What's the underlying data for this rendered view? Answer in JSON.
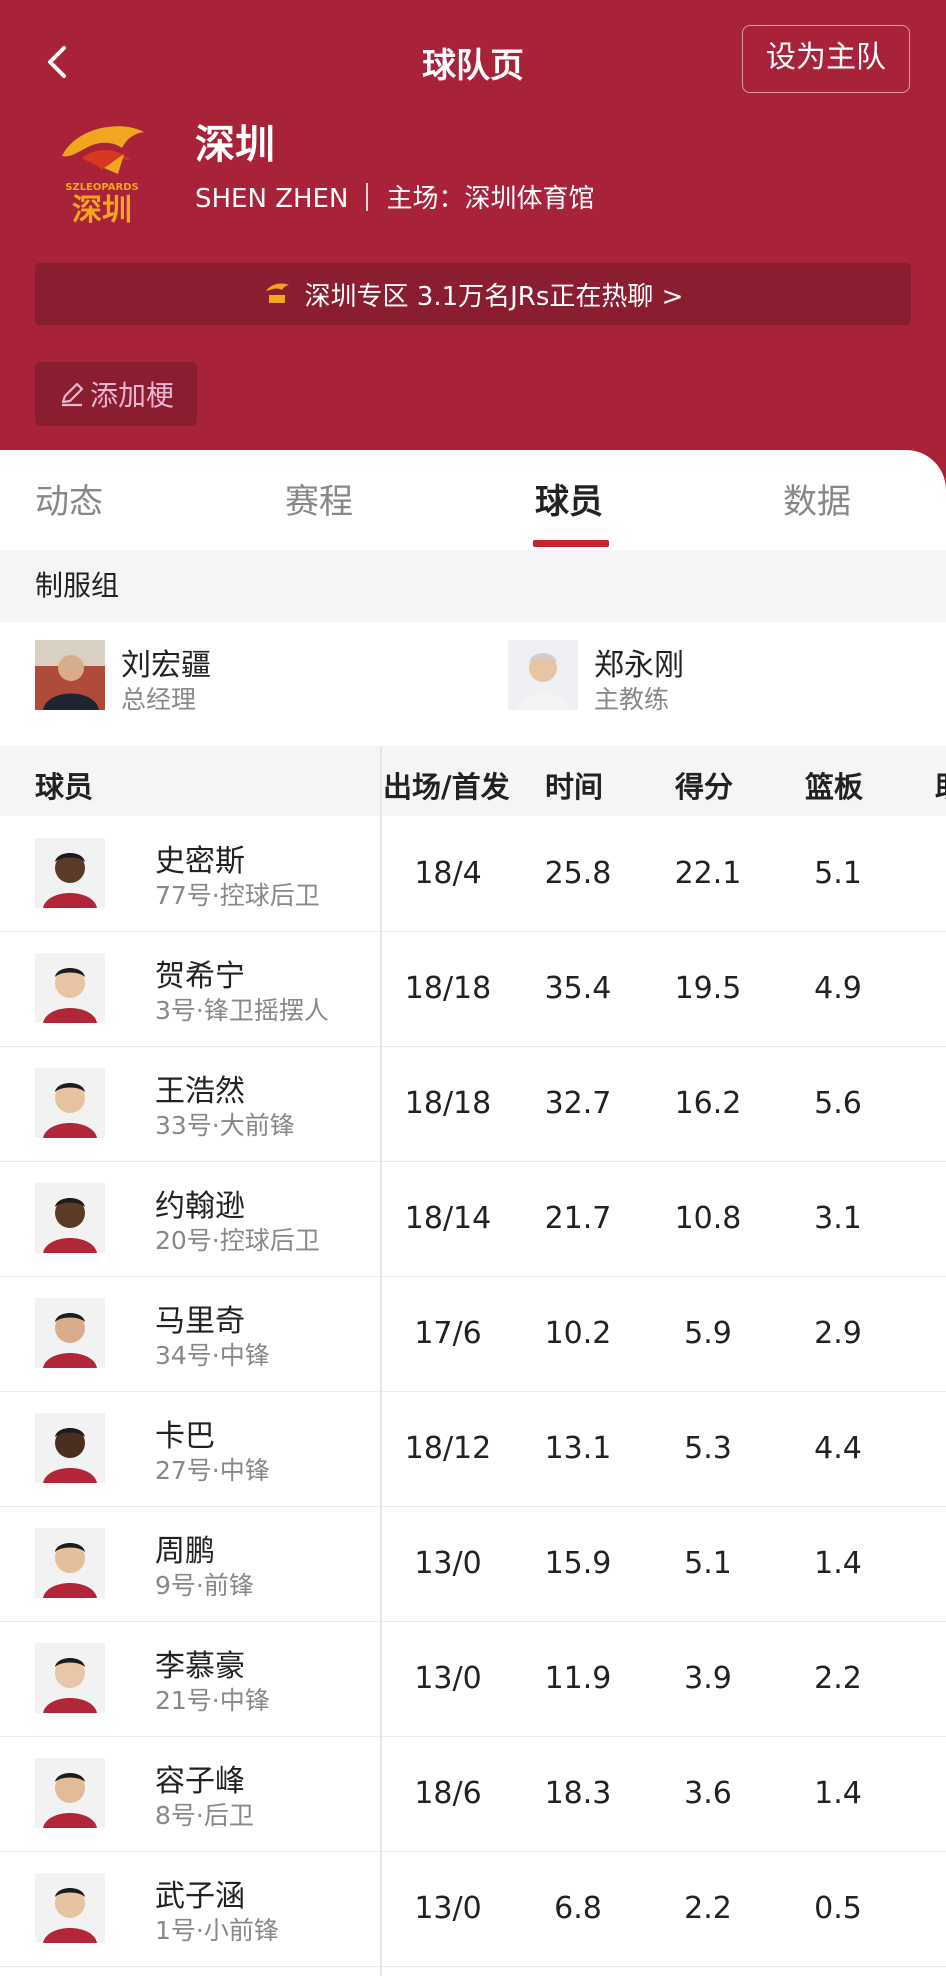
{
  "header": {
    "title": "球队页",
    "set_home_label": "设为主队",
    "team_name": "深圳",
    "team_pinyin": "SHEN ZHEN",
    "home_court": "主场：深圳体育馆",
    "hot_text": "深圳专区 3.1万名JRs正在热聊 >",
    "add_meme_label": "添加梗",
    "logo_text_top": "SZLEOPARDS",
    "logo_text_main": "深圳",
    "colors": {
      "header_bg": "#a8223a",
      "accent": "#c8232c",
      "logo_gold": "#f2a61f"
    }
  },
  "tabs": [
    {
      "label": "动态"
    },
    {
      "label": "赛程"
    },
    {
      "label": "球员",
      "active": true
    },
    {
      "label": "数据"
    }
  ],
  "staff": {
    "section_title": "制服组",
    "members": [
      {
        "name": "刘宏疆",
        "role": "总经理"
      },
      {
        "name": "郑永刚",
        "role": "主教练"
      }
    ]
  },
  "table": {
    "headers": [
      "球员",
      "出场/首发",
      "时间",
      "得分",
      "篮板",
      "助"
    ],
    "rows": [
      {
        "name": "史密斯",
        "position": "77号·控球后卫",
        "games": "18/4",
        "minutes": "25.8",
        "points": "22.1",
        "rebounds": "5.1",
        "skin": "#5a3a28"
      },
      {
        "name": "贺希宁",
        "position": "3号·锋卫摇摆人",
        "games": "18/18",
        "minutes": "35.4",
        "points": "19.5",
        "rebounds": "4.9",
        "skin": "#e8c4a4"
      },
      {
        "name": "王浩然",
        "position": "33号·大前锋",
        "games": "18/18",
        "minutes": "32.7",
        "points": "16.2",
        "rebounds": "5.6",
        "skin": "#e6c2a0"
      },
      {
        "name": "约翰逊",
        "position": "20号·控球后卫",
        "games": "18/14",
        "minutes": "21.7",
        "points": "10.8",
        "rebounds": "3.1",
        "skin": "#5b3a26"
      },
      {
        "name": "马里奇",
        "position": "34号·中锋",
        "games": "17/6",
        "minutes": "10.2",
        "points": "5.9",
        "rebounds": "2.9",
        "skin": "#d9ad8c"
      },
      {
        "name": "卡巴",
        "position": "27号·中锋",
        "games": "18/12",
        "minutes": "13.1",
        "points": "5.3",
        "rebounds": "4.4",
        "skin": "#4a2e20"
      },
      {
        "name": "周鹏",
        "position": "9号·前锋",
        "games": "13/0",
        "minutes": "15.9",
        "points": "5.1",
        "rebounds": "1.4",
        "skin": "#e4bf9c"
      },
      {
        "name": "李慕豪",
        "position": "21号·中锋",
        "games": "13/0",
        "minutes": "11.9",
        "points": "3.9",
        "rebounds": "2.2",
        "skin": "#e8c6a8"
      },
      {
        "name": "容子峰",
        "position": "8号·后卫",
        "games": "18/6",
        "minutes": "18.3",
        "points": "3.6",
        "rebounds": "1.4",
        "skin": "#e2bc98"
      },
      {
        "name": "武子涵",
        "position": "1号·小前锋",
        "games": "13/0",
        "minutes": "6.8",
        "points": "2.2",
        "rebounds": "0.5",
        "skin": "#e6c4a2"
      }
    ]
  }
}
